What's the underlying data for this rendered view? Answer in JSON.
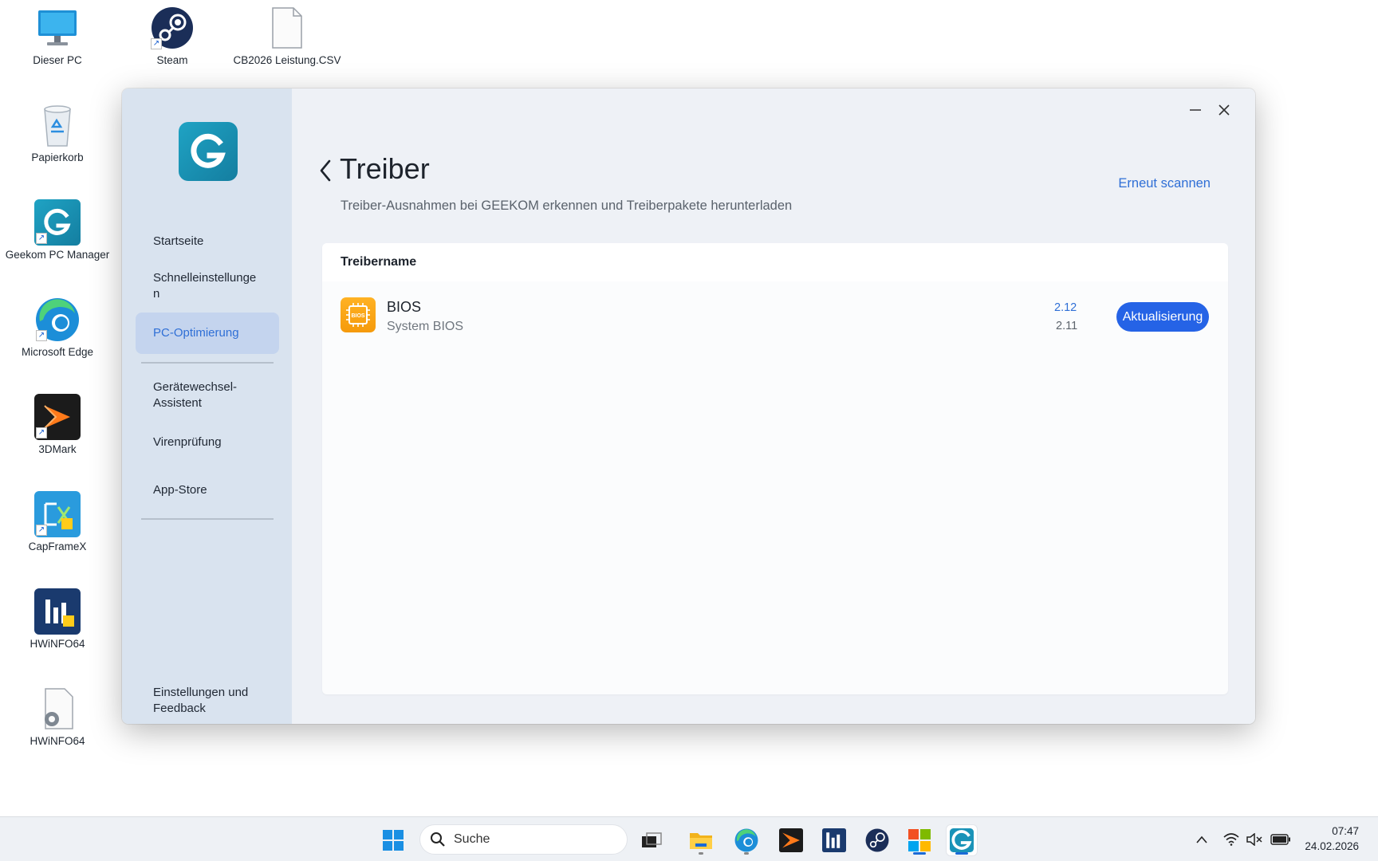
{
  "desktop": {
    "icons": [
      {
        "label": "Dieser PC",
        "icon": "computer-icon"
      },
      {
        "label": "Steam",
        "icon": "steam-icon"
      },
      {
        "label": "CB2026 Leistung.CSV",
        "icon": "file-icon"
      },
      {
        "label": "Papierkorb",
        "icon": "recycle-bin-icon"
      },
      {
        "label": "Geekom PC Manager",
        "icon": "geekom-icon"
      },
      {
        "label": "Microsoft Edge",
        "icon": "edge-icon"
      },
      {
        "label": "3DMark",
        "icon": "3dmark-icon"
      },
      {
        "label": "CapFrameX",
        "icon": "capframex-icon"
      },
      {
        "label": "HWiNFO64",
        "icon": "hwinfo-icon"
      },
      {
        "label": "HWiNFO64",
        "icon": "settings-file-icon"
      }
    ]
  },
  "app": {
    "sidebar": {
      "items": [
        {
          "label": "Startseite"
        },
        {
          "label": "Schnelleinstellunge n"
        },
        {
          "label": "PC-Optimierung",
          "active": true
        },
        {
          "label": "Gerätewechsel-Assistent"
        },
        {
          "label": "Virenprüfung"
        },
        {
          "label": "App-Store"
        }
      ],
      "footer": "Einstellungen und Feedback"
    },
    "window_controls": {
      "minimize": "—",
      "close": "✕"
    },
    "page": {
      "title": "Treiber",
      "subtitle": "Treiber-Ausnahmen bei GEEKOM erkennen und Treiberpakete herunterladen",
      "rescan_label": "Erneut scannen"
    },
    "table": {
      "header": "Treibername",
      "rows": [
        {
          "icon_text": "BIOS",
          "name": "BIOS",
          "description": "System BIOS",
          "new_version": "2.12",
          "current_version": "2.11",
          "action_label": "Aktualisierung"
        }
      ]
    }
  },
  "taskbar": {
    "search_placeholder": "Suche",
    "time": "07:47",
    "date": "24.02.2026"
  },
  "colors": {
    "accent": "#2563e6",
    "link": "#2f6fd6",
    "sidebar_bg": "#d9e3ef",
    "active_nav_bg": "#c4d4ee",
    "bios_orange": "#f59a0b"
  }
}
